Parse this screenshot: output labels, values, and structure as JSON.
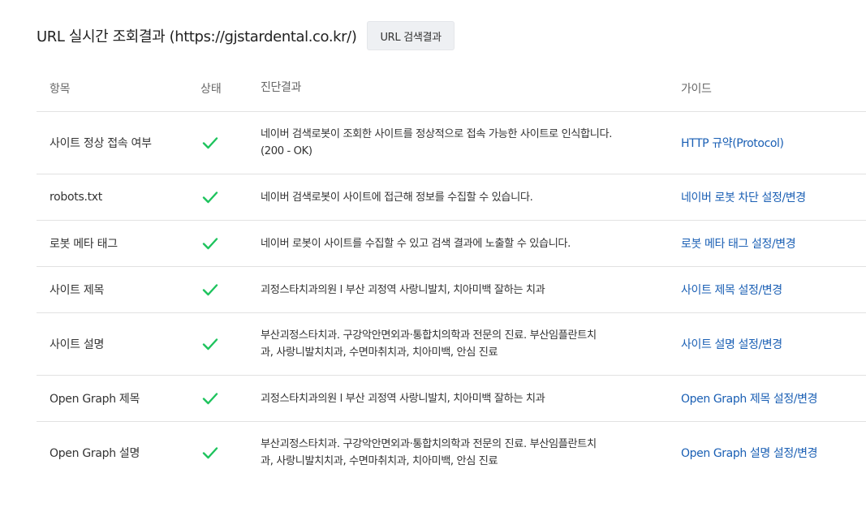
{
  "header": {
    "title": "URL 실시간 조회결과 (https://gjstardental.co.kr/)",
    "url_button_label": "URL 검색결과"
  },
  "table": {
    "columns": {
      "item": "항목",
      "status": "상태",
      "result": "진단결과",
      "guide": "가이드"
    },
    "rows": [
      {
        "item": "사이트 정상 접속 여부",
        "status": "pass",
        "result": "네이버 검색로봇이 조회한 사이트를 정상적으로 접속 가능한 사이트로 인식합니다.",
        "result_line2": "(200 - OK)",
        "guide": "HTTP 규약(Protocol)"
      },
      {
        "item": "robots.txt",
        "status": "pass",
        "result": "네이버 검색로봇이 사이트에 접근해 정보를 수집할 수 있습니다.",
        "result_line2": "",
        "guide": "네이버 로봇 차단 설정/변경"
      },
      {
        "item": "로봇 메타 태그",
        "status": "pass",
        "result": "네이버 로봇이 사이트를 수집할 수 있고 검색 결과에 노출할 수 있습니다.",
        "result_line2": "",
        "guide": "로봇 메타 태그 설정/변경"
      },
      {
        "item": "사이트 제목",
        "status": "pass",
        "result": "괴정스타치과의원 l 부산 괴정역 사랑니발치, 치아미백 잘하는 치과",
        "result_line2": "",
        "guide": "사이트 제목 설정/변경"
      },
      {
        "item": "사이트 설명",
        "status": "pass",
        "result": "부산괴정스타치과. 구강악안면외과·통합치의학과 전문의 진료. 부산임플란트치",
        "result_line2": "과, 사랑니발치치과, 수면마취치과, 치아미백, 안심 진료",
        "guide": "사이트 설명 설정/변경"
      },
      {
        "item": "Open Graph 제목",
        "status": "pass",
        "result": "괴정스타치과의원 l 부산 괴정역 사랑니발치, 치아미백 잘하는 치과",
        "result_line2": "",
        "guide": "Open Graph 제목 설정/변경"
      },
      {
        "item": "Open Graph 설명",
        "status": "pass",
        "result": "부산괴정스타치과. 구강악안면외과·통합치의학과 전문의 진료. 부산임플란트치",
        "result_line2": "과, 사랑니발치치과, 수면마취치과, 치아미백, 안심 진료",
        "guide": "Open Graph 설명 설정/변경"
      }
    ]
  },
  "icons": {
    "status_pass": "check-icon"
  },
  "colors": {
    "check": "#1ec35d",
    "link": "#1a5fb4",
    "button_bg": "#eef0f3",
    "divider": "#e2e2e2"
  }
}
